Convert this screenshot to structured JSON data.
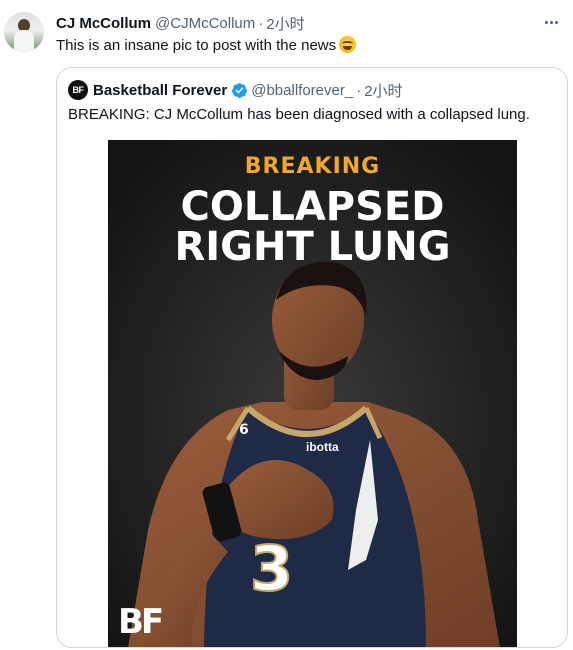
{
  "tweet": {
    "author_name": "CJ McCollum",
    "author_handle": "@CJMcCollum",
    "separator": "·",
    "time": "2小时",
    "text": "This is an insane pic to post with the news",
    "emoji": "grinning-face-with-sweat",
    "more_icon": "more-horizontal-icon"
  },
  "quoted_tweet": {
    "author_name": "Basketball Forever",
    "author_avatar_text": "BF",
    "verified": true,
    "verified_color": "#1d9bf0",
    "author_handle": "@bballforever_",
    "separator": "·",
    "time": "2小时",
    "text": "BREAKING: CJ McCollum has been diagnosed with a collapsed lung.",
    "image": {
      "tag": "BREAKING",
      "headline_line1": "COLLAPSED",
      "headline_line2": "RIGHT LUNG",
      "tag_color": "#f4a62a",
      "jersey_sponsor": "ibotta",
      "jersey_number": "3",
      "jersey_number_small": "6",
      "logo": "BF"
    }
  },
  "colors": {
    "text_primary": "#0f1419",
    "text_secondary": "#536471",
    "border": "#cfd9de"
  }
}
